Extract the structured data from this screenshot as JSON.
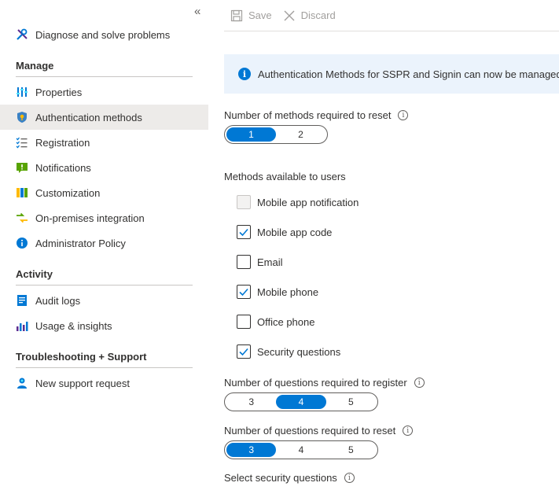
{
  "sidebar": {
    "collapse_glyph": "«",
    "top_item": {
      "label": "Diagnose and solve problems",
      "icon": "wrench-icon"
    },
    "sections": [
      {
        "title": "Manage",
        "items": [
          {
            "label": "Properties",
            "icon": "properties-icon"
          },
          {
            "label": "Authentication methods",
            "icon": "shield-key-icon",
            "selected": true
          },
          {
            "label": "Registration",
            "icon": "checklist-icon"
          },
          {
            "label": "Notifications",
            "icon": "notification-icon"
          },
          {
            "label": "Customization",
            "icon": "customization-icon"
          },
          {
            "label": "On-premises integration",
            "icon": "sync-icon"
          },
          {
            "label": "Administrator Policy",
            "icon": "info-icon"
          }
        ]
      },
      {
        "title": "Activity",
        "items": [
          {
            "label": "Audit logs",
            "icon": "audit-log-icon"
          },
          {
            "label": "Usage & insights",
            "icon": "chart-icon"
          }
        ]
      },
      {
        "title": "Troubleshooting + Support",
        "items": [
          {
            "label": "New support request",
            "icon": "person-support-icon"
          }
        ]
      }
    ]
  },
  "toolbar": {
    "save_label": "Save",
    "discard_label": "Discard"
  },
  "banner": {
    "text": "Authentication Methods for SSPR and Signin can now be managed in one place"
  },
  "methods_required": {
    "label": "Number of methods required to reset",
    "options": [
      "1",
      "2"
    ],
    "selected": "1"
  },
  "methods_available": {
    "label": "Methods available to users",
    "items": [
      {
        "label": "Mobile app notification",
        "checked": false,
        "disabled": true
      },
      {
        "label": "Mobile app code",
        "checked": true
      },
      {
        "label": "Email",
        "checked": false
      },
      {
        "label": "Mobile phone",
        "checked": true
      },
      {
        "label": "Office phone",
        "checked": false
      },
      {
        "label": "Security questions",
        "checked": true
      }
    ]
  },
  "questions_register": {
    "label": "Number of questions required to register",
    "options": [
      "3",
      "4",
      "5"
    ],
    "selected": "4"
  },
  "questions_reset": {
    "label": "Number of questions required to reset",
    "options": [
      "3",
      "4",
      "5"
    ],
    "selected": "3"
  },
  "select_questions": {
    "label": "Select security questions"
  },
  "colors": {
    "accent": "#0078d4",
    "selected_bg": "#edebe9",
    "banner_bg": "#ebf3fc"
  }
}
